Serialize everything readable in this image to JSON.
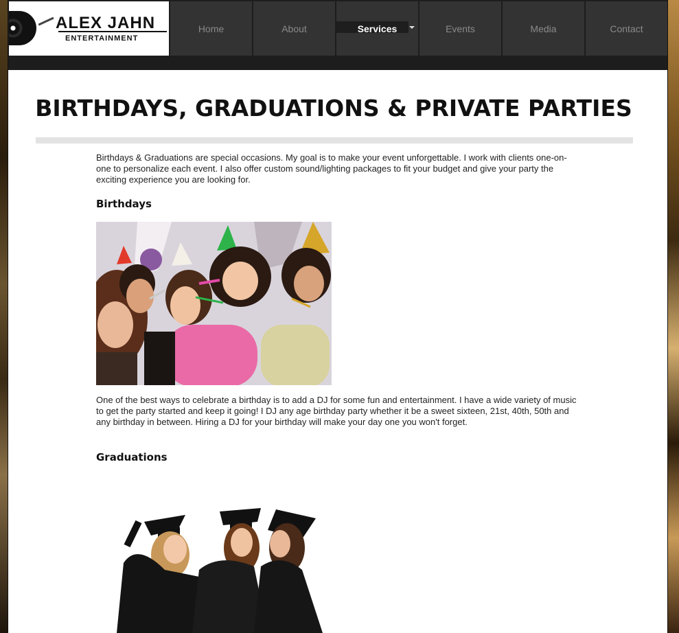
{
  "logo": {
    "title": "ALEX JAHN",
    "subtitle": "ENTERTAINMENT"
  },
  "nav": {
    "items": [
      {
        "label": "Home"
      },
      {
        "label": "About"
      },
      {
        "label": "Services"
      },
      {
        "label": "Events"
      },
      {
        "label": "Media"
      },
      {
        "label": "Contact"
      }
    ],
    "active": "Services"
  },
  "page": {
    "title": "BIRTHDAYS, GRADUATIONS & PRIVATE PARTIES",
    "intro": "Birthdays & Graduations are special occasions. My goal is to make your event unforgettable. I work with clients one-on-one to personalize each event. I also offer custom sound/lighting packages to fit your budget and give your party the exciting experience you are looking for.",
    "sections": [
      {
        "heading": "Birthdays",
        "body": "One of the best ways to celebrate a birthday is to add a DJ for some fun and entertainment. I have a wide variety of music to get the party started and keep it going! I DJ any age birthday party whether it be a sweet sixteen, 21st, 40th, 50th and any birthday in between. Hiring a DJ for your birthday will make your day one you won't forget."
      },
      {
        "heading": "Graduations"
      }
    ]
  }
}
